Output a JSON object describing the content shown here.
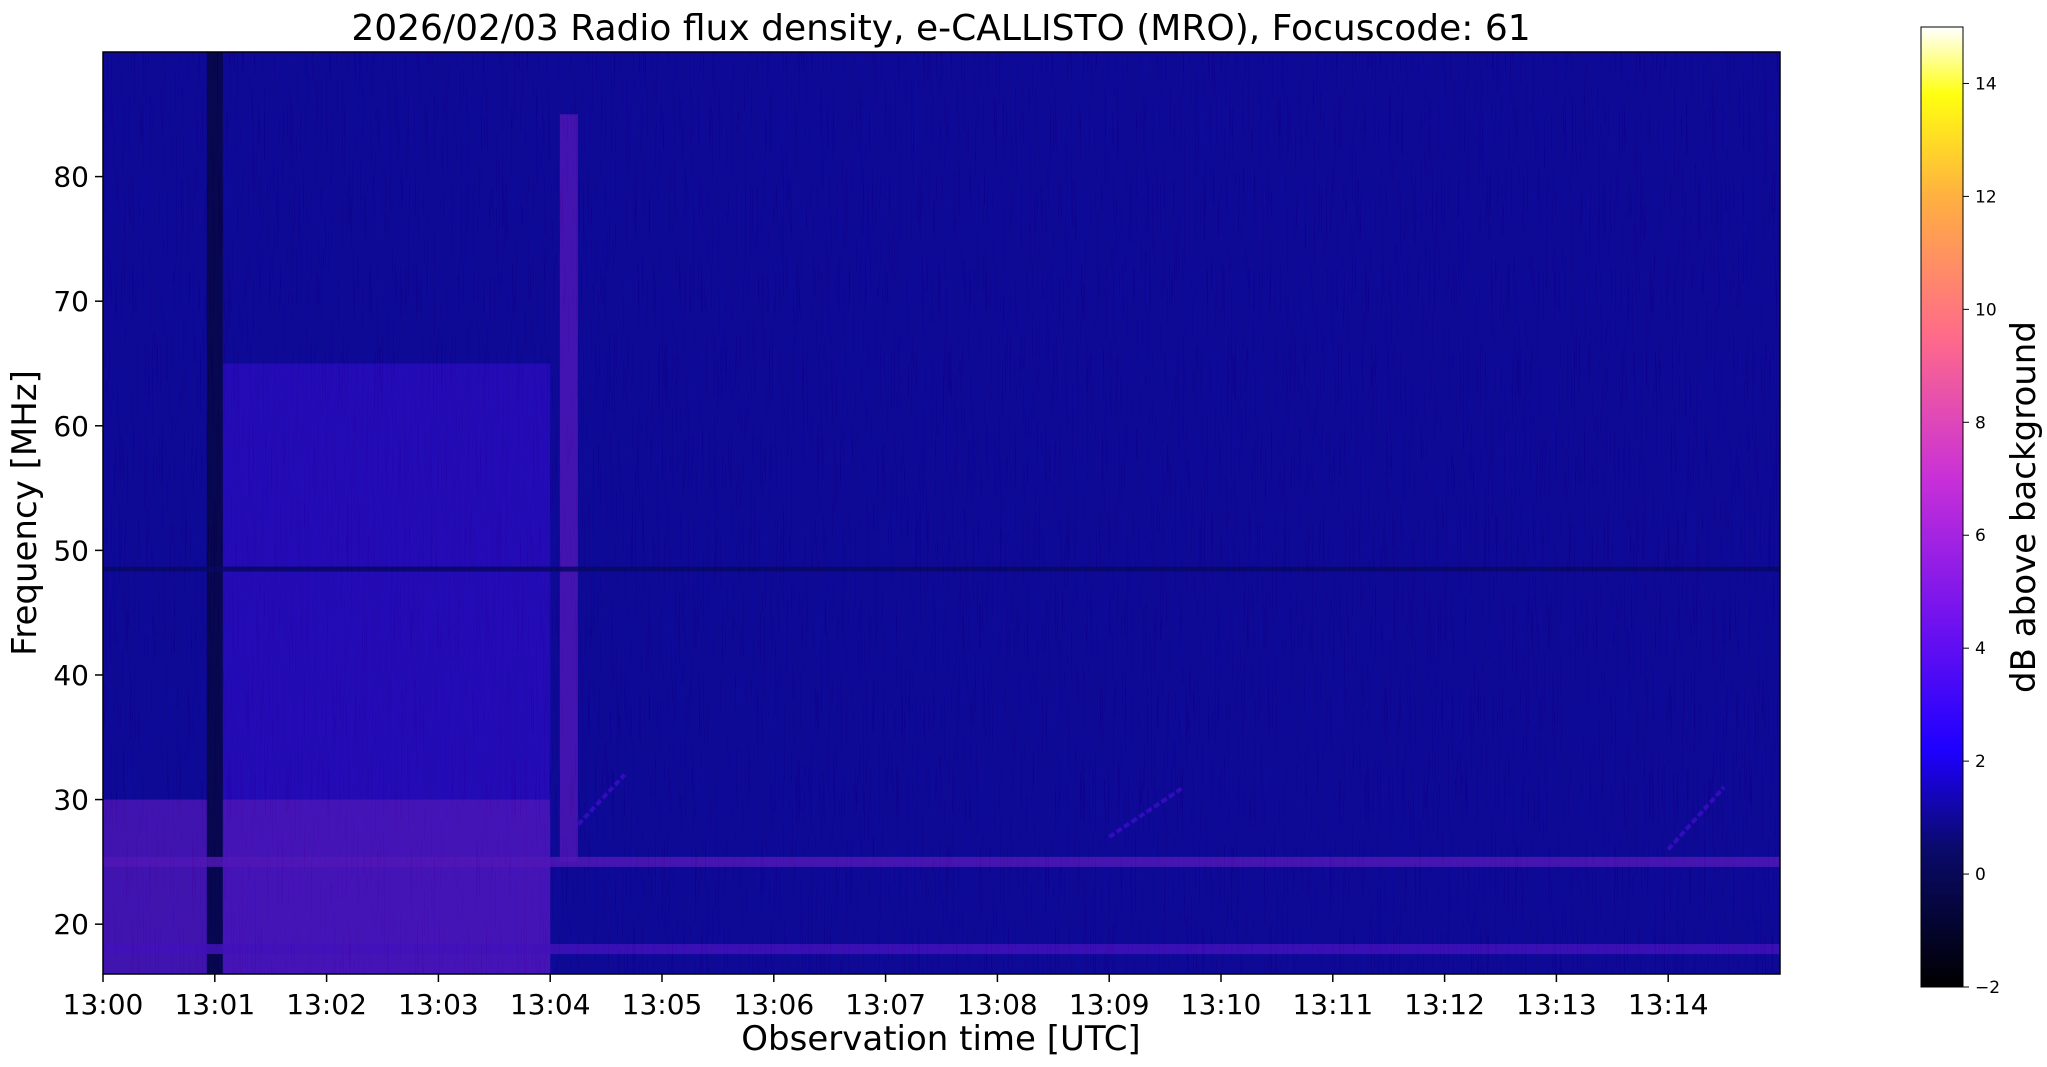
{
  "chart_data": {
    "type": "heatmap",
    "title": "2026/02/03  Radio flux density, e-CALLISTO (MRO), Focuscode: 61",
    "xlabel": "Observation time [UTC]",
    "ylabel": "Frequency [MHz]",
    "x_ticks": [
      "13:00",
      "13:01",
      "13:02",
      "13:03",
      "13:04",
      "13:05",
      "13:06",
      "13:07",
      "13:08",
      "13:09",
      "13:10",
      "13:11",
      "13:12",
      "13:13",
      "13:14"
    ],
    "xlim": [
      "13:00",
      "13:15"
    ],
    "y_ticks": [
      20,
      30,
      40,
      50,
      60,
      70,
      80
    ],
    "ylim": [
      16,
      90
    ],
    "colorbar": {
      "label": "dB above background",
      "ticks": [
        -2,
        0,
        2,
        4,
        6,
        8,
        10,
        12,
        14
      ],
      "range": [
        -2,
        15
      ],
      "colormap": "gnuplot2",
      "stops": [
        {
          "value": -2,
          "color": "#000000"
        },
        {
          "value": 0.5,
          "color": "#0a0a6e"
        },
        {
          "value": 2.2,
          "color": "#1e00ff"
        },
        {
          "value": 4.3,
          "color": "#6a10f0"
        },
        {
          "value": 7.0,
          "color": "#c830d8"
        },
        {
          "value": 9.5,
          "color": "#ff6a8a"
        },
        {
          "value": 12,
          "color": "#ffb040"
        },
        {
          "value": 13.8,
          "color": "#ffff10"
        },
        {
          "value": 15,
          "color": "#ffffff"
        }
      ]
    },
    "features": [
      {
        "name": "broadband enhancement",
        "t_start": "13:01",
        "t_end": "13:04",
        "f_low": 16,
        "f_high": 65,
        "level_db": 3.5
      },
      {
        "name": "lower band enhancement",
        "t_start": "13:00",
        "t_end": "13:04",
        "f_low": 16,
        "f_high": 30,
        "level_db": 6
      },
      {
        "name": "vertical dropout",
        "t": "13:01",
        "level_db": -2
      },
      {
        "name": "vertical burst",
        "t": "13:04:10",
        "f_low": 25,
        "f_high": 85,
        "level_db": 6
      },
      {
        "name": "drifting burst",
        "t_start": "13:04:15",
        "t_end": "13:04:40",
        "f_start": 28,
        "f_end": 32,
        "level_db": 4
      },
      {
        "name": "drifting burst",
        "t_start": "13:09:00",
        "t_end": "13:09:40",
        "f_start": 27,
        "f_end": 31,
        "level_db": 4
      },
      {
        "name": "drifting burst",
        "t_start": "13:14:00",
        "t_end": "13:14:30",
        "f_start": 26,
        "f_end": 31,
        "level_db": 4
      },
      {
        "name": "interference line",
        "f": 48.5,
        "level_db": -1
      },
      {
        "name": "interference band",
        "f": 25,
        "level_db": 6
      },
      {
        "name": "interference band",
        "f": 18,
        "level_db": 5
      }
    ]
  }
}
